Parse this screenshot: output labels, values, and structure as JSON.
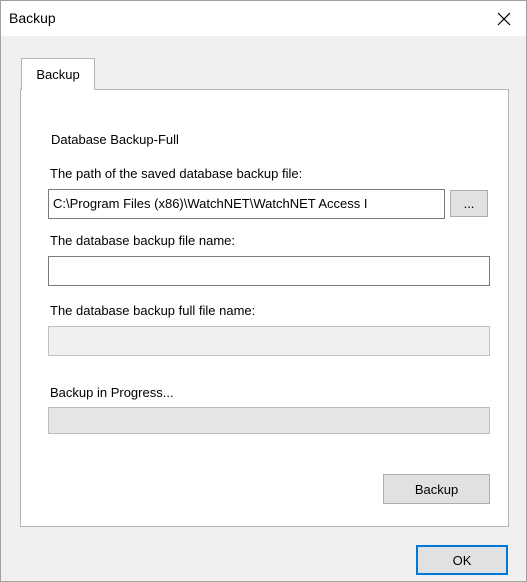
{
  "window": {
    "title": "Backup"
  },
  "tabs": [
    {
      "label": "Backup",
      "selected": true
    }
  ],
  "panel": {
    "section_title": "Database Backup-Full",
    "path_label": "The path of the saved database backup file:",
    "path_value": "C:\\Program Files (x86)\\WatchNET\\WatchNET Access I",
    "browse_label": "...",
    "file_name_label": "The database backup file name:",
    "file_name_value": "",
    "full_file_name_label": "The database backup full file name:",
    "full_file_name_value": "",
    "progress_label": "Backup in Progress...",
    "progress_value": 0,
    "backup_button": "Backup"
  },
  "footer": {
    "ok_button": "OK"
  },
  "colors": {
    "accent": "#0078d7",
    "dialog_bg": "#f0f0f0",
    "panel_bg": "#ffffff"
  }
}
